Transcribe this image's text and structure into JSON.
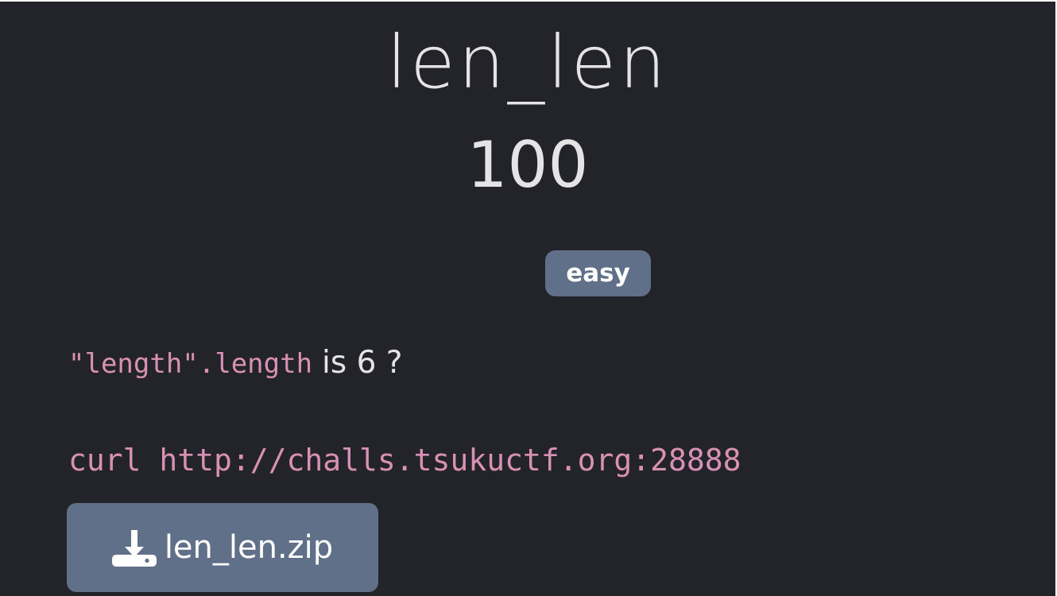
{
  "challenge": {
    "title": "len_len",
    "points": "100",
    "difficulty": "easy",
    "description": {
      "code": "\"length\".length",
      "text": "is 6 ?"
    },
    "command": "curl http://challs.tsukuctf.org:28888",
    "attachment": {
      "icon": "download-icon",
      "label": "len_len.zip"
    }
  },
  "colors": {
    "background": "#232429",
    "accent": "#617089",
    "code": "#d891b5",
    "text": "#e4e4e7"
  }
}
